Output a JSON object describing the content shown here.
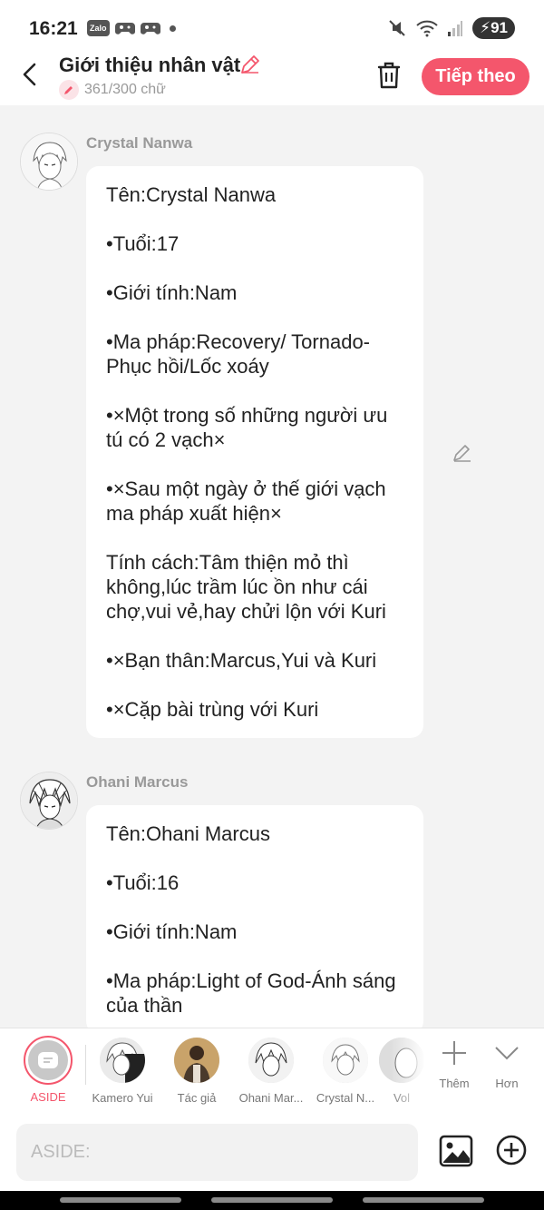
{
  "status": {
    "time": "16:21",
    "apps": [
      "Zalo",
      "game",
      "game"
    ],
    "battery": "91"
  },
  "header": {
    "title": "Giới thiệu nhân vật",
    "char_count": "361/300 chữ",
    "next_label": "Tiếp theo"
  },
  "messages": [
    {
      "sender": "Crystal Nanwa",
      "lines": [
        "Tên:Crystal Nanwa",
        "•Tuổi:17",
        "•Giới tính:Nam",
        "•Ma pháp:Recovery/ Tornado-Phục hồi/Lốc xoáy",
        "•×Một trong số những người ưu tú có 2 vạch×",
        "•×Sau một ngày ở thế giới vạch ma pháp xuất hiện×",
        "Tính cách:Tâm thiện mỏ thì không,lúc trầm lúc ồn như cái chợ,vui vẻ,hay chửi lộn với Kuri",
        "•×Bạn thân:Marcus,Yui và Kuri",
        "•×Cặp bài trùng với Kuri"
      ]
    },
    {
      "sender": "Ohani Marcus",
      "lines": [
        "Tên:Ohani Marcus",
        "•Tuổi:16",
        "•Giới tính:Nam",
        "•Ma pháp:Light of God-Ánh sáng của thần"
      ]
    }
  ],
  "characters": {
    "aside_label": "ASIDE",
    "items": [
      "Kamero Yui",
      "Tác giả",
      "Ohani Mar...",
      "Crystal N...",
      "Vol"
    ],
    "add_label": "Thêm",
    "more_label": "Hơn"
  },
  "input": {
    "placeholder": "ASIDE:"
  },
  "colors": {
    "accent": "#f4566c"
  }
}
